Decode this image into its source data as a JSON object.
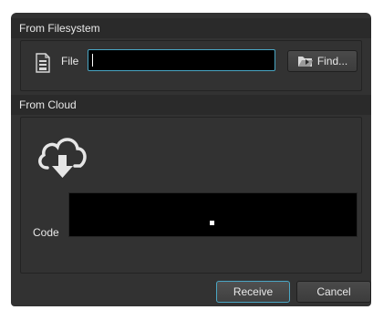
{
  "filesystem": {
    "header": "From Filesystem",
    "file_label": "File",
    "file_value": "",
    "find_label": "Find..."
  },
  "cloud": {
    "header": "From Cloud",
    "code_label": "Code",
    "code_value": ""
  },
  "buttons": {
    "receive": "Receive",
    "cancel": "Cancel"
  },
  "icons": {
    "file": "document-archive-icon",
    "find": "open-folder-icon",
    "cloud": "cloud-download-icon"
  },
  "colors": {
    "background": "#323232",
    "header": "#2a2a2a",
    "focus_accent": "#4aa6c4",
    "text": "#e8e8e8"
  }
}
